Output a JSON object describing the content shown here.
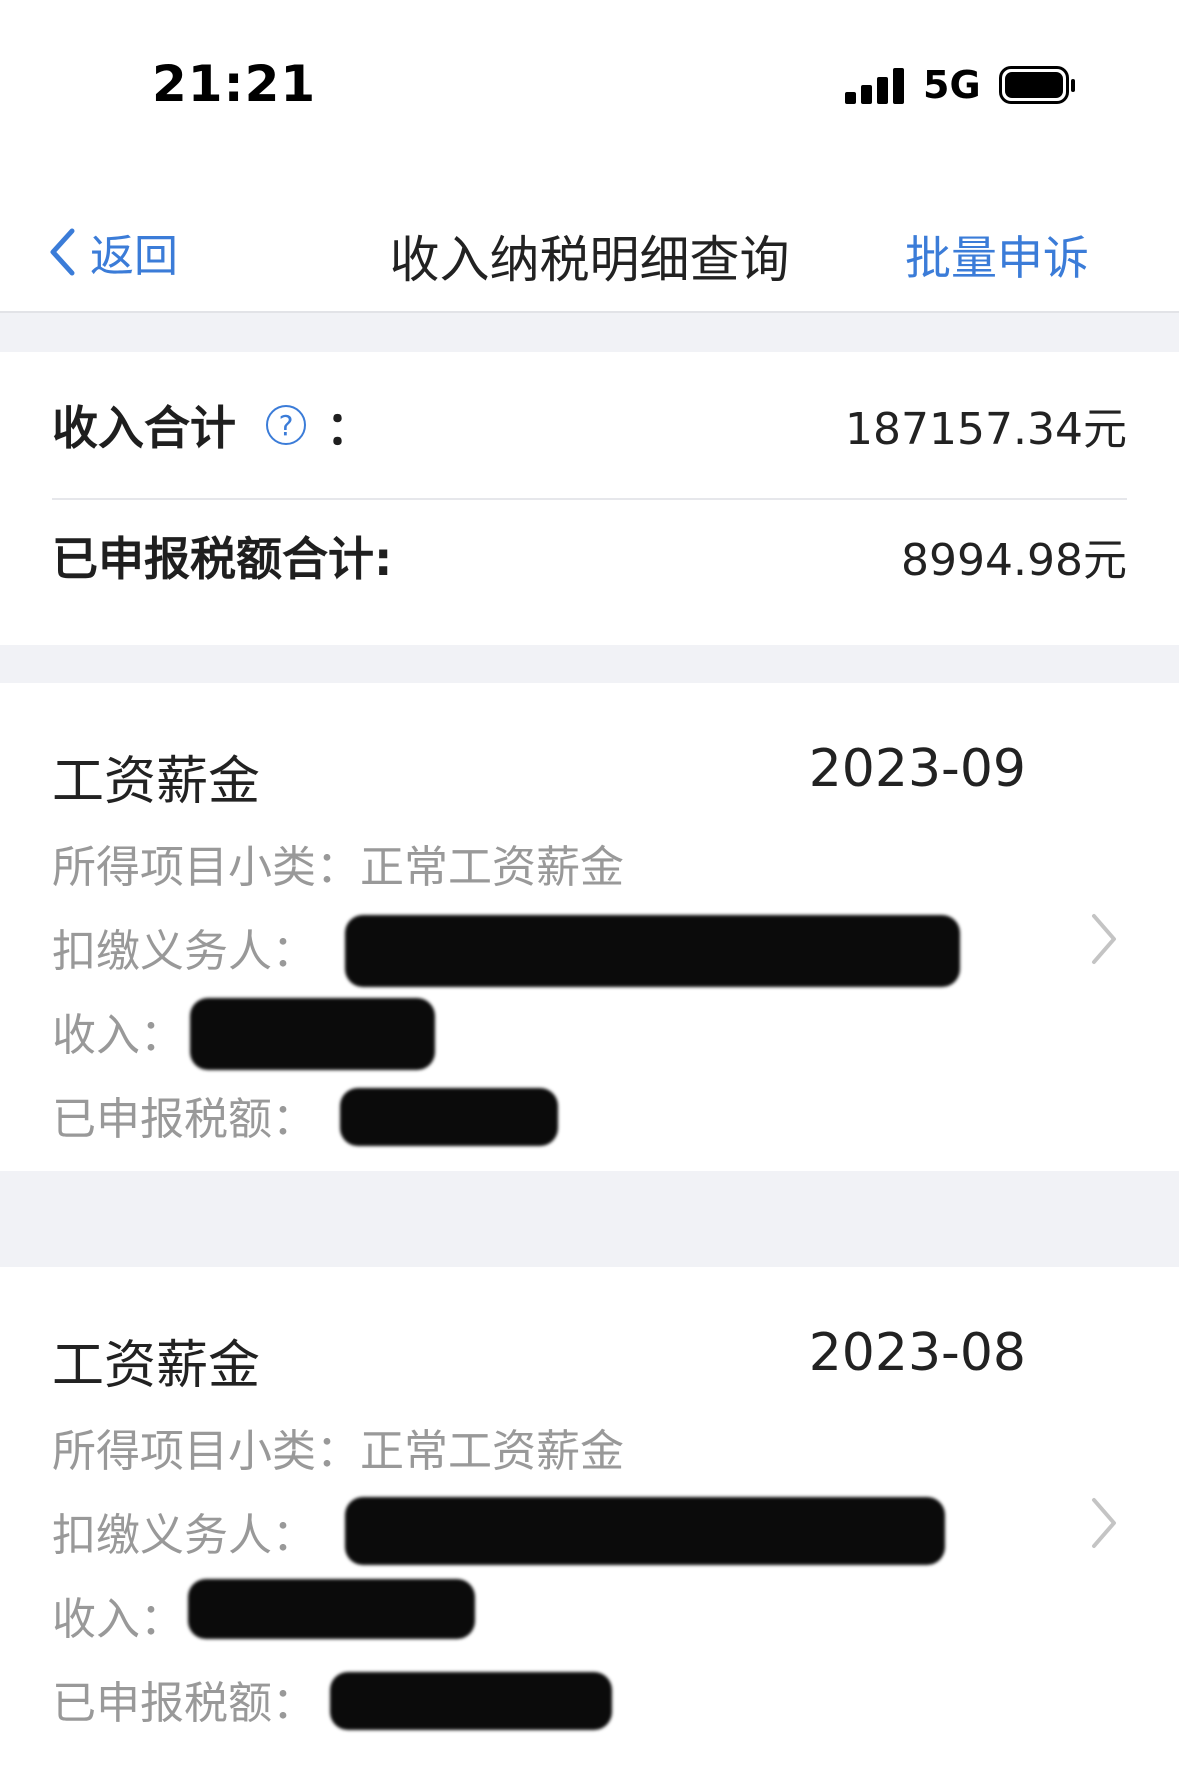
{
  "status_bar": {
    "time": "21:21",
    "network": "5G"
  },
  "nav": {
    "back_label": "返回",
    "title": "收入纳税明细查询",
    "action_label": "批量申诉"
  },
  "summary": {
    "income_label": "收入合计",
    "income_colon": "：",
    "income_value": "187157.34元",
    "tax_label": "已申报税额合计:",
    "tax_value": "8994.98元"
  },
  "records": [
    {
      "title": "工资薪金",
      "date": "2023-09",
      "subcategory_label": "所得项目小类：",
      "subcategory_value": "正常工资薪金",
      "withholder_label": "扣缴义务人：",
      "income_label": "收入：",
      "tax_label": "已申报税额："
    },
    {
      "title": "工资薪金",
      "date": "2023-08",
      "subcategory_label": "所得项目小类：",
      "subcategory_value": "正常工资薪金",
      "withholder_label": "扣缴义务人：",
      "income_label": "收入：",
      "tax_label": "已申报税额："
    }
  ],
  "colors": {
    "accent": "#3b7cd8",
    "background": "#f1f2f6",
    "muted_text": "#999999"
  },
  "icons": [
    "back-chevron-icon",
    "help-icon",
    "chevron-right-icon",
    "signal-icon",
    "battery-icon"
  ]
}
